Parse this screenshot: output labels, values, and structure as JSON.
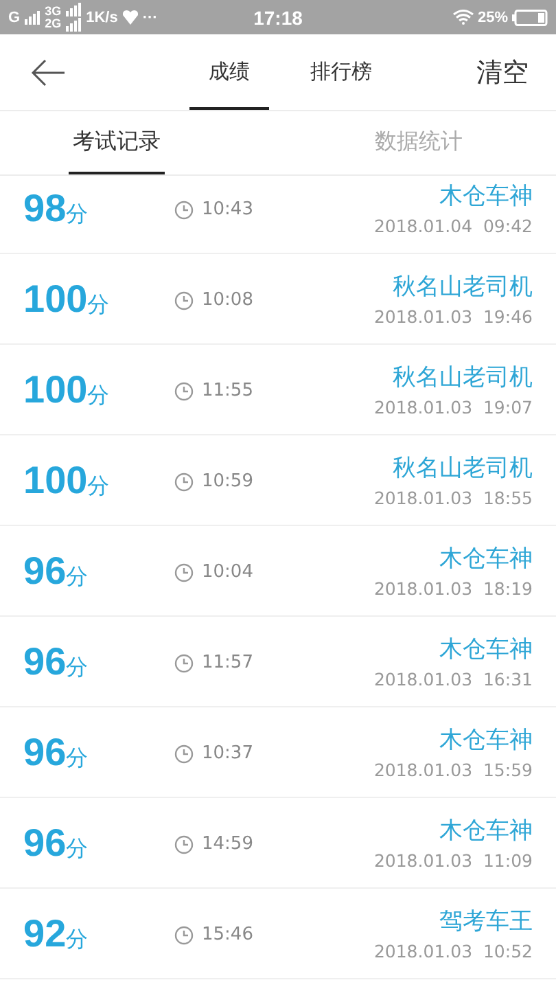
{
  "status_bar": {
    "network_1": "G",
    "network_2_top": "3G",
    "network_2_bottom": "2G",
    "speed": "1K/s",
    "more": "···",
    "time": "17:18",
    "battery": "25%"
  },
  "header": {
    "tabs": [
      {
        "label": "成绩",
        "selected": true
      },
      {
        "label": "排行榜",
        "selected": false
      }
    ],
    "action": "清空"
  },
  "subtabs": [
    {
      "label": "考试记录",
      "selected": true
    },
    {
      "label": "数据统计",
      "selected": false
    }
  ],
  "records": [
    {
      "score": "98",
      "unit": "分",
      "duration": "10:43",
      "name": "木仓车神",
      "date": "2018.01.04  09:42"
    },
    {
      "score": "100",
      "unit": "分",
      "duration": "10:08",
      "name": "秋名山老司机",
      "date": "2018.01.03  19:46"
    },
    {
      "score": "100",
      "unit": "分",
      "duration": "11:55",
      "name": "秋名山老司机",
      "date": "2018.01.03  19:07"
    },
    {
      "score": "100",
      "unit": "分",
      "duration": "10:59",
      "name": "秋名山老司机",
      "date": "2018.01.03  18:55"
    },
    {
      "score": "96",
      "unit": "分",
      "duration": "10:04",
      "name": "木仓车神",
      "date": "2018.01.03  18:19"
    },
    {
      "score": "96",
      "unit": "分",
      "duration": "11:57",
      "name": "木仓车神",
      "date": "2018.01.03  16:31"
    },
    {
      "score": "96",
      "unit": "分",
      "duration": "10:37",
      "name": "木仓车神",
      "date": "2018.01.03  15:59"
    },
    {
      "score": "96",
      "unit": "分",
      "duration": "14:59",
      "name": "木仓车神",
      "date": "2018.01.03  11:09"
    },
    {
      "score": "92",
      "unit": "分",
      "duration": "15:46",
      "name": "驾考车王",
      "date": "2018.01.03  10:52"
    }
  ]
}
